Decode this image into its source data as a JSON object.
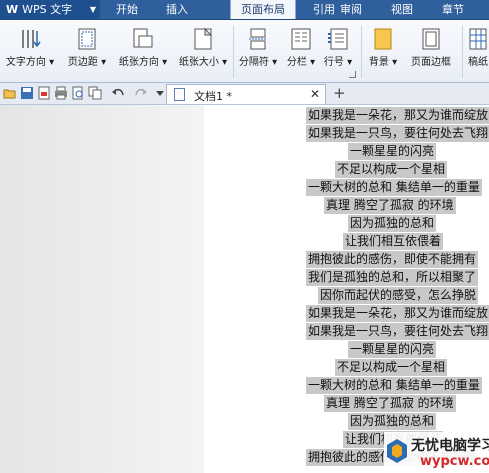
{
  "app": {
    "title": "WPS 文字"
  },
  "menu": [
    "开始",
    "插入",
    "页面布局",
    "引用",
    "审阅",
    "视图",
    "章节"
  ],
  "ribbon": {
    "buttons": [
      {
        "label": "文字方向 ▾",
        "icon": "text-direction-icon"
      },
      {
        "label": "页边距 ▾",
        "icon": "margins-icon"
      },
      {
        "label": "纸张方向 ▾",
        "icon": "orientation-icon"
      },
      {
        "label": "纸张大小 ▾",
        "icon": "paper-size-icon"
      },
      {
        "label": "分隔符 ▾",
        "icon": "separator-icon"
      },
      {
        "label": "分栏 ▾",
        "icon": "columns-icon"
      },
      {
        "label": "行号 ▾",
        "icon": "line-numbers-icon"
      },
      {
        "label": "背景 ▾",
        "icon": "background-icon"
      },
      {
        "label": "页面边框",
        "icon": "page-border-icon"
      },
      {
        "label": "稿纸",
        "icon": "draft-paper-icon"
      }
    ]
  },
  "quickbar": {
    "icons": [
      "open-folder-icon",
      "save-icon",
      "export-pdf-icon",
      "print-icon",
      "print-preview-icon",
      "copy-icon",
      "undo-icon",
      "redo-icon",
      "customize-icon"
    ]
  },
  "tab": {
    "title": "文档1 *",
    "close": "✕",
    "add": "+"
  },
  "document": {
    "lines": [
      "如果我是一朵花，那又为谁而绽放",
      "如果我是一只鸟，要往何处去飞翔",
      "一颗星星的闪亮",
      "不足以构成一个星相",
      "一颗大树的总和 集结单一的重量",
      "真理 腾空了孤寂 的环境",
      "因为孤独的总和",
      "让我们相互依偎着",
      "拥抱彼此的感伤，即使不能拥有",
      "我们是孤独的总和，所以相聚了",
      "因你而起伏的感受，怎么挣脱",
      "如果我是一朵花，那又为谁而绽放",
      "如果我是一只鸟，要往何处去飞翔",
      "一颗星星的闪亮",
      "不足以构成一个星相",
      "一颗大树的总和 集结单一的重量",
      "真理 腾空了孤寂 的环境",
      "因为孤独的总和",
      "让我们相互依偎着",
      "拥抱彼此的感伤，即使不能拥有"
    ],
    "highlight_color": "#c8c8c8"
  },
  "watermark": {
    "title": "无忧电脑学习网",
    "url": "wypcw.com"
  },
  "colors": {
    "menubar": "#2f5f9c",
    "accent": "#1e4f8f",
    "watermark_url": "#d12b2b"
  }
}
